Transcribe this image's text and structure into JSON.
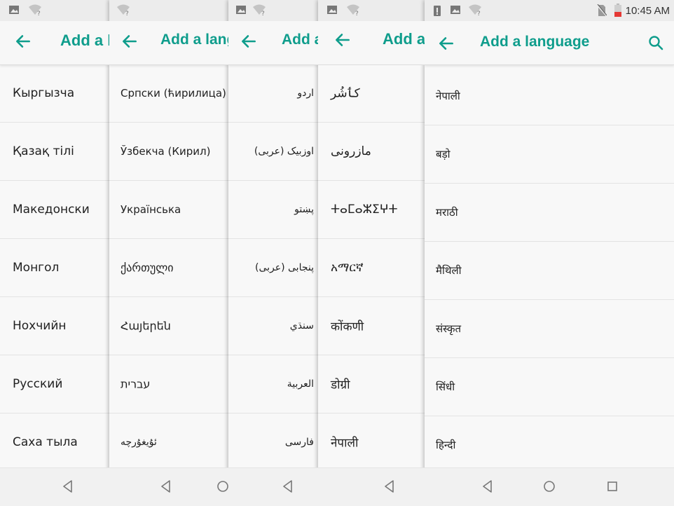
{
  "panels": [
    {
      "title": "Add a language",
      "items": [
        "Кыргызча",
        "Қазақ тілі",
        "Македонски",
        "Монгол",
        "Нохчийн",
        "Русский",
        "Саха тыла"
      ]
    },
    {
      "title": "Add a language",
      "items": [
        "Српски (ћирилица)",
        "Ўзбекча (Кирил)",
        "Українська",
        "ქართული",
        "Հայերեն",
        "עברית",
        "ئۇيغۇرچە"
      ]
    },
    {
      "title": "Add a language",
      "items": [
        "اردو",
        "اوزبیک (عربی)",
        "پښتو",
        "پنجابی (عربی)",
        "سنڌي",
        "العربية",
        "فارسی"
      ]
    },
    {
      "title": "Add a language",
      "items": [
        "کٲشُر",
        "مازرونی",
        "ⵜⴰⵎⴰⵣⵉⵖⵜ",
        "አማርኛ",
        "कोंकणी",
        "डोग्री",
        "नेपाली"
      ]
    },
    {
      "title": "Add a language",
      "items": [
        "नेपाली",
        "बड़ो",
        "मराठी",
        "मैथिली",
        "संस्कृत",
        "सिंधी",
        "हिन्दी"
      ]
    }
  ],
  "status": {
    "time": "10:45 AM"
  },
  "colors": {
    "accent": "#0f9d8c"
  },
  "icons": {
    "back": "arrow-left-icon",
    "search": "search-icon",
    "nav_back": "triangle-back-icon",
    "nav_home": "circle-home-icon",
    "nav_recents": "square-recents-icon"
  }
}
